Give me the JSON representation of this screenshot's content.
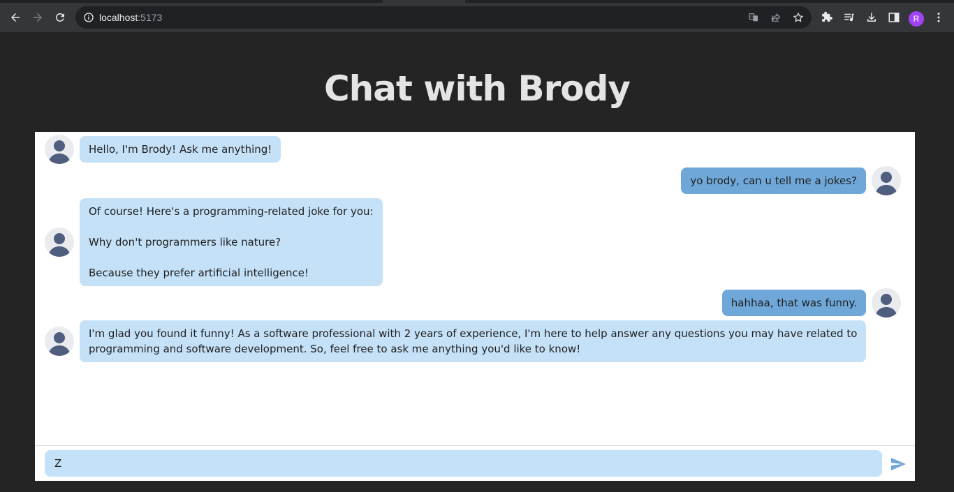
{
  "browser": {
    "url_host": "localhost",
    "url_port": ":5173",
    "profile_initial": "R"
  },
  "page": {
    "title": "Chat with Brody"
  },
  "messages": [
    {
      "sender": "bot",
      "text": "Hello, I'm Brody! Ask me anything!"
    },
    {
      "sender": "user",
      "text": "yo brody, can u tell me a jokes?"
    },
    {
      "sender": "bot",
      "text": "Of course! Here's a programming-related joke for you:\n\nWhy don't programmers like nature?\n\nBecause they prefer artificial intelligence!"
    },
    {
      "sender": "user",
      "text": "hahhaa, that was funny."
    },
    {
      "sender": "bot",
      "text": "I'm glad you found it funny! As a software professional with 2 years of experience, I'm here to help answer any questions you may have related to\nprogramming and software development. So, feel free to ask me anything you'd like to know!"
    }
  ],
  "composer": {
    "value": "Z"
  },
  "colors": {
    "bot_bubble": "#c5e1f8",
    "user_bubble": "#6fa7d8",
    "send_icon": "#6fa7d8",
    "page_bg": "#242424"
  }
}
